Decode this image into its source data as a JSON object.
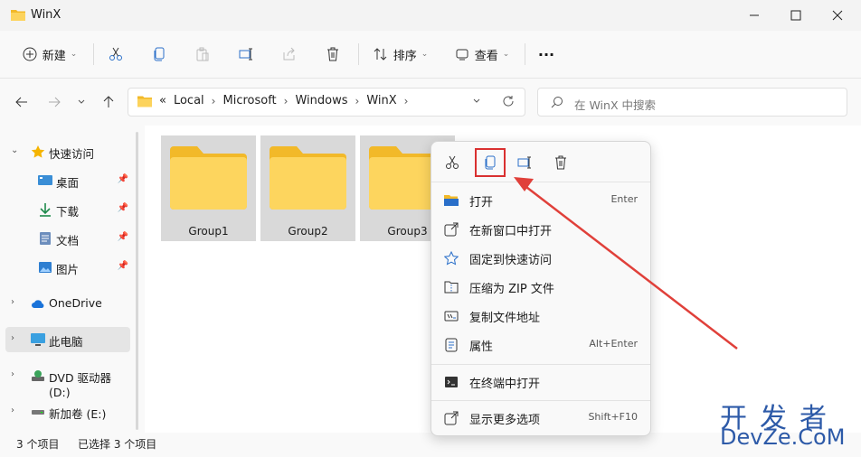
{
  "window": {
    "title": "WinX"
  },
  "toolbar": {
    "new_label": "新建",
    "sort_label": "排序",
    "view_label": "查看",
    "more_label": "···"
  },
  "nav": {
    "crumbs": [
      "«",
      "Local",
      "Microsoft",
      "Windows",
      "WinX"
    ],
    "search_placeholder": "在 WinX 中搜索"
  },
  "sidebar": {
    "items": [
      {
        "label": "快速访问"
      },
      {
        "label": "桌面"
      },
      {
        "label": "下载"
      },
      {
        "label": "文档"
      },
      {
        "label": "图片"
      },
      {
        "label": "OneDrive"
      },
      {
        "label": "此电脑"
      },
      {
        "label": "DVD 驱动器 (D:)"
      },
      {
        "label": "新加卷 (E:)"
      }
    ]
  },
  "folders": [
    {
      "name": "Group1"
    },
    {
      "name": "Group2"
    },
    {
      "name": "Group3"
    }
  ],
  "context_menu": {
    "items": [
      {
        "label": "打开",
        "shortcut": "Enter"
      },
      {
        "label": "在新窗口中打开",
        "shortcut": ""
      },
      {
        "label": "固定到快速访问",
        "shortcut": ""
      },
      {
        "label": "压缩为 ZIP 文件",
        "shortcut": ""
      },
      {
        "label": "复制文件地址",
        "shortcut": ""
      },
      {
        "label": "属性",
        "shortcut": "Alt+Enter"
      },
      {
        "label": "在终端中打开",
        "shortcut": ""
      },
      {
        "label": "显示更多选项",
        "shortcut": "Shift+F10"
      }
    ]
  },
  "status": {
    "count": "3 个项目",
    "selected": "已选择 3 个项目"
  },
  "watermark": {
    "line1": "开发者",
    "line2": "DevZe.CoM"
  },
  "colors": {
    "accent": "#0067c0",
    "folder": "#f7c948",
    "highlight": "#d93030",
    "watermark": "#2d5aa8"
  }
}
